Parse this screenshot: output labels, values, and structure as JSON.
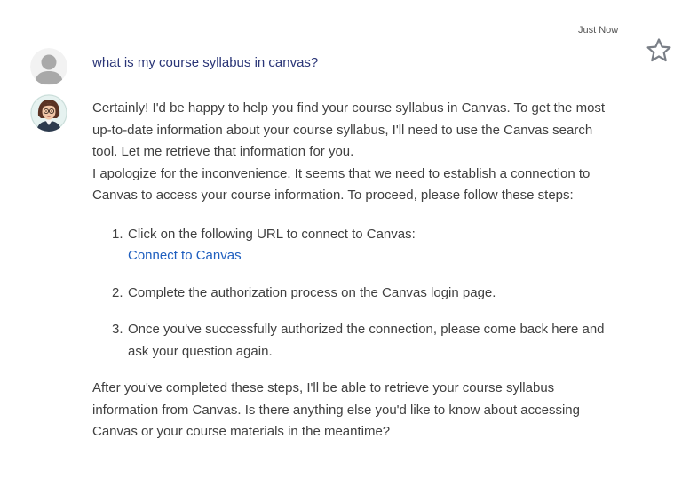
{
  "message": {
    "timestamp": "Just Now",
    "star_icon": "star-outline-icon",
    "user_avatar_icon": "default-user-avatar-icon",
    "assistant_avatar_icon": "assistant-avatar-woman-glasses-icon",
    "user_question": "what is my course syllabus in canvas?",
    "assistant": {
      "para1": "Certainly! I'd be happy to help you find your course syllabus in Canvas. To get the most up-to-date information about your course syllabus, I'll need to use the Canvas search tool. Let me retrieve that information for you.",
      "para2": "I apologize for the inconvenience. It seems that we need to establish a connection to Canvas to access your course information. To proceed, please follow these steps:",
      "steps": [
        {
          "num": "1.",
          "text": "Click on the following URL to connect to Canvas:",
          "link_text": "Connect to Canvas"
        },
        {
          "num": "2.",
          "text": "Complete the authorization process on the Canvas login page."
        },
        {
          "num": "3.",
          "text": "Once you've successfully authorized the connection, please come back here and ask your question again."
        }
      ],
      "closing": "After you've completed these steps, I'll be able to retrieve your course syllabus information from Canvas. Is there anything else you'd like to know about accessing Canvas or your course materials in the meantime?"
    }
  },
  "colors": {
    "question_text": "#2a3577",
    "body_text": "#404040",
    "link": "#1f5fbf",
    "star_stroke": "#7a7f87"
  }
}
